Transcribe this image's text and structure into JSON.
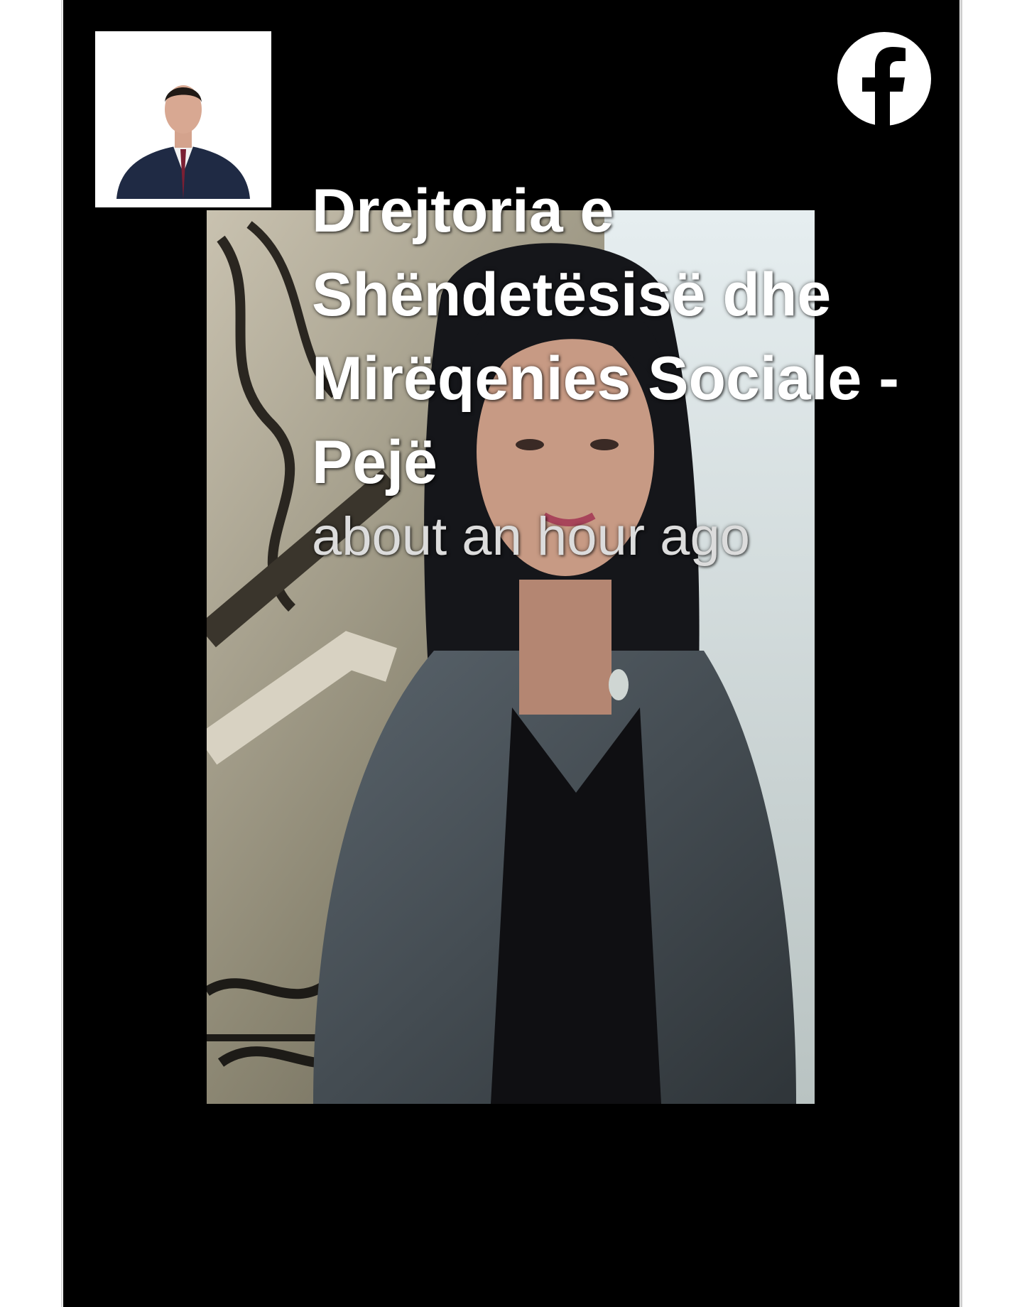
{
  "post": {
    "page_name": "Drejtoria e Shëndetësisë dhe Mirëqenies Sociale - Pejë",
    "timestamp": "about an hour ago",
    "avatar": {
      "description": "man-in-suit-portrait"
    },
    "photo": {
      "description": "woman-with-long-dark-hair-on-staircase"
    }
  },
  "brand": {
    "logo_icon": "facebook-icon",
    "logo_color": "#ffffff",
    "card_background": "#000000"
  }
}
